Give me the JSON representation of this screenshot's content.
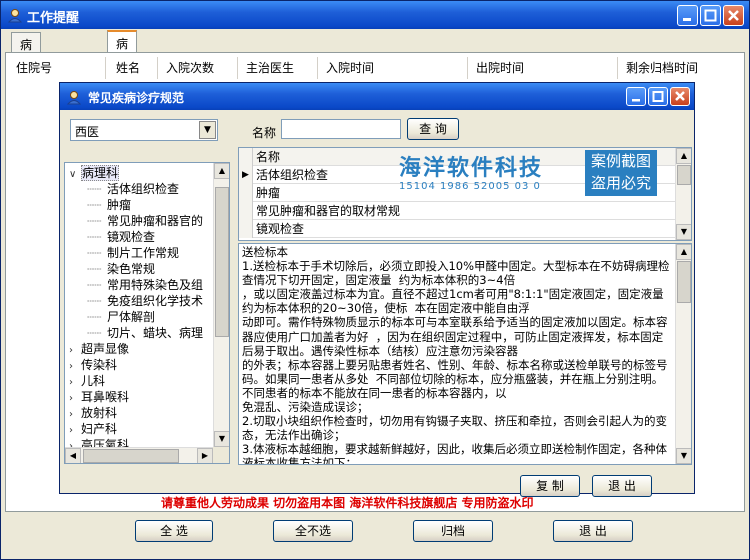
{
  "window": {
    "title": "工作提醒"
  },
  "tabs": [
    {
      "label": "病历书写提醒"
    },
    {
      "label": "病历归档提醒"
    }
  ],
  "table_headers": [
    "住院号",
    "姓名",
    "入院次数",
    "主治医生",
    "入院时间",
    "出院时间",
    "剩余归档时间"
  ],
  "dialog": {
    "title": "常见疾病诊疗规范",
    "category_select": "西医",
    "name_label": "名称",
    "query_button": "查 询",
    "copy_button": "复 制",
    "exit_button": "退 出",
    "tree": [
      {
        "label": "病理科",
        "type": "expanded"
      },
      {
        "label": "活体组织检查",
        "type": "child"
      },
      {
        "label": "肿瘤",
        "type": "child"
      },
      {
        "label": "常见肿瘤和器官的",
        "type": "child"
      },
      {
        "label": "镜观检查",
        "type": "child"
      },
      {
        "label": "制片工作常规",
        "type": "child"
      },
      {
        "label": "染色常规",
        "type": "child"
      },
      {
        "label": "常用特殊染色及组",
        "type": "child"
      },
      {
        "label": "免疫组织化学技术",
        "type": "child"
      },
      {
        "label": "尸体解剖",
        "type": "child"
      },
      {
        "label": "切片、蜡块、病理",
        "type": "child"
      },
      {
        "label": "超声显像",
        "type": "collapsed"
      },
      {
        "label": "传染科",
        "type": "collapsed"
      },
      {
        "label": "儿科",
        "type": "collapsed"
      },
      {
        "label": "耳鼻喉科",
        "type": "collapsed"
      },
      {
        "label": "放射科",
        "type": "collapsed"
      },
      {
        "label": "妇产科",
        "type": "collapsed"
      },
      {
        "label": "高压氧科",
        "type": "collapsed"
      }
    ],
    "grid": {
      "header": "名称",
      "rows": [
        "活体组织检查",
        "肿瘤",
        "常见肿瘤和器官的取材常规",
        "镜观检查"
      ]
    },
    "watermark": {
      "title": "海洋软件科技",
      "code": "15104 1986 52005 03 0",
      "side": "案例截图 盗用必究"
    },
    "detail_text": "送检标本\n1.送检标本于手术切除后，必须立即投入10%甲醛中固定。大型标本在不妨碍病理检查情况下切开固定，固定液量  约为标本体积的3~4倍\n，或以固定液盖过标本为宜。直径不超过1cm者可用\"8:1:1\"固定液固定，固定液量约为标本体积的20~30倍，使标  本在固定液中能自由浮\n动即可。需作特殊物质显示的标本可与本室联系给予适当的固定液加以固定。标本容器应使用广口加盖者为好  ，因为在组织固定过程中，可防止固定液挥发，标本固定后易于取出。遇传染性标本（结核）应注意勿污染容器\n的外表；标本容器上要另贴患者姓名、性别、年龄、标本名称或送检单联号的标签号码。如果同一患者从多处  不同部位切除的标本，应分瓶盛装，并在瓶上分别注明。不同患者的标本不能放在同一患者的标本容器内，以\n免混乱、污染造成误诊；\n2.切取小块组织作检查时，切勿用有钩镊子夹取、挤压和牵拉，否则会引起人为的变态，无法作出确诊；\n3.体液标本越细胞，要求越新鲜越好，因此，收集后必须立即送检制作固定，各种体液标本收集方法如下："
  },
  "notice": "请尊重他人劳动成果  切勿盗用本图  海洋软件科技旗舰店  专用防盗水印",
  "footer": {
    "select_all": "全 选",
    "deselect_all": "全不选",
    "archive": "归档",
    "exit": "退 出"
  }
}
